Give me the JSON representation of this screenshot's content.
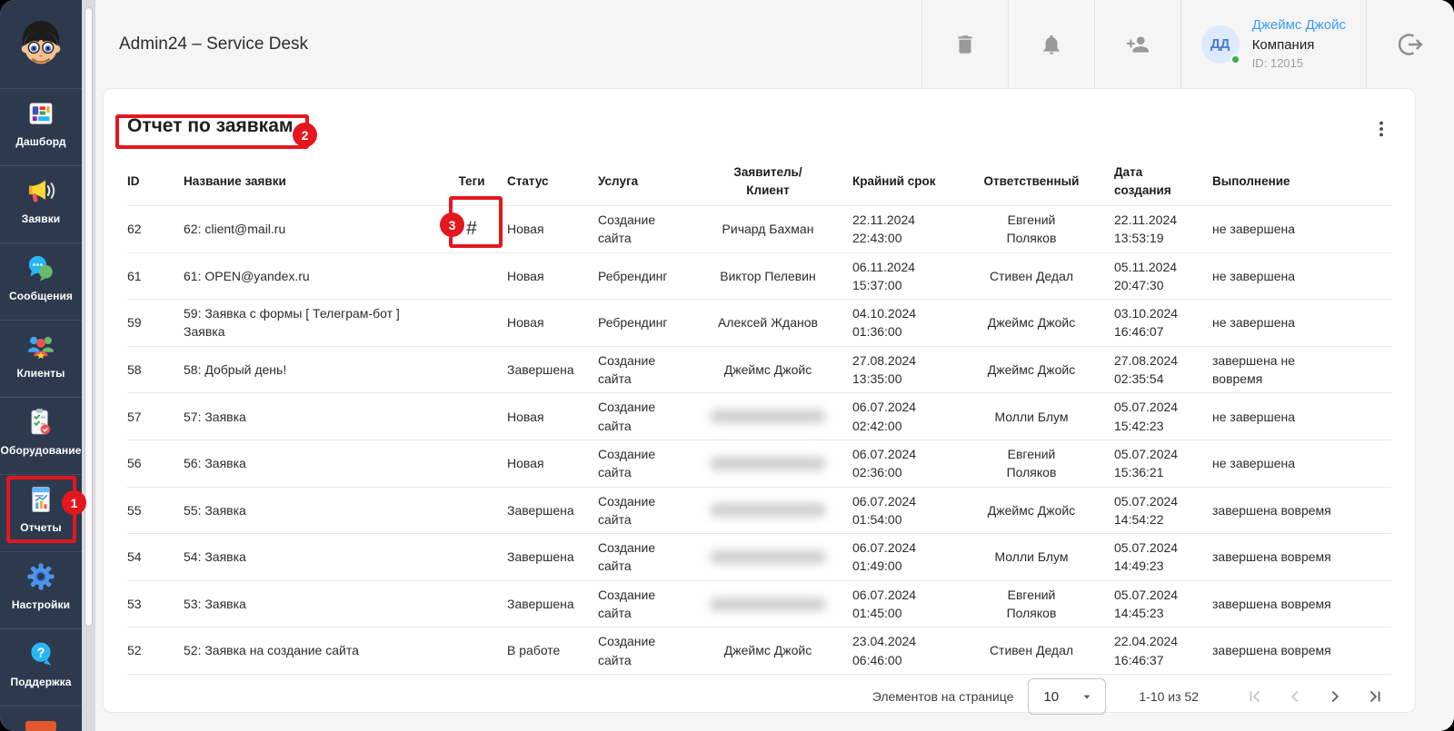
{
  "app": {
    "title": "Admin24 – Service Desk"
  },
  "sidebar": {
    "items": [
      {
        "key": "dashboard",
        "label": "Дашборд",
        "icon": "icon-dashboard"
      },
      {
        "key": "requests",
        "label": "Заявки",
        "icon": "icon-megaphone"
      },
      {
        "key": "messages",
        "label": "Сообщения",
        "icon": "icon-chat"
      },
      {
        "key": "clients",
        "label": "Клиенты",
        "icon": "icon-clients"
      },
      {
        "key": "equipment",
        "label": "Оборудование",
        "icon": "icon-equipment"
      },
      {
        "key": "reports",
        "label": "Отчеты",
        "icon": "icon-reports",
        "active": true
      },
      {
        "key": "settings",
        "label": "Настройки",
        "icon": "icon-settings"
      },
      {
        "key": "support",
        "label": "Поддержка",
        "icon": "icon-support"
      }
    ]
  },
  "header": {
    "user": {
      "initials": "ДД",
      "name": "Джеймс Джойс",
      "company": "Компания",
      "id_label": "ID: 12015"
    }
  },
  "main": {
    "title": "Отчет по заявкам",
    "table": {
      "columns": [
        {
          "key": "id",
          "label": "ID"
        },
        {
          "key": "name",
          "label": "Название заявки"
        },
        {
          "key": "tags",
          "label": "Теги"
        },
        {
          "key": "status",
          "label": "Статус"
        },
        {
          "key": "service",
          "label": "Услуга"
        },
        {
          "key": "client",
          "label": "Заявитель/\nКлиент"
        },
        {
          "key": "deadline",
          "label": "Крайний срок"
        },
        {
          "key": "responsible",
          "label": "Ответственный"
        },
        {
          "key": "created",
          "label": "Дата создания"
        },
        {
          "key": "completion",
          "label": "Выполнение"
        }
      ],
      "rows": [
        {
          "id": "62",
          "name": "62: client@mail.ru",
          "tags": "#",
          "status": "Новая",
          "service": "Создание сайта",
          "client": "Ричард Бахман",
          "client_blurred": false,
          "deadline": "22.11.2024 22:43:00",
          "responsible": "Евгений Поляков",
          "created": "22.11.2024 13:53:19",
          "completion": "не завершена"
        },
        {
          "id": "61",
          "name": "61: OPEN@yandex.ru",
          "tags": "",
          "status": "Новая",
          "service": "Ребрендинг",
          "client": "Виктор Пелевин",
          "client_blurred": false,
          "deadline": "06.11.2024 15:37:00",
          "responsible": "Стивен Дедал",
          "created": "05.11.2024 20:47:30",
          "completion": "не завершена"
        },
        {
          "id": "59",
          "name": "59: Заявка с формы [ Телеграм-бот ] Заявка",
          "tags": "",
          "status": "Новая",
          "service": "Ребрендинг",
          "client": "Алексей Жданов",
          "client_blurred": false,
          "deadline": "04.10.2024 01:36:00",
          "responsible": "Джеймс Джойс",
          "created": "03.10.2024 16:46:07",
          "completion": "не завершена"
        },
        {
          "id": "58",
          "name": "58: Добрый день!",
          "tags": "",
          "status": "Завершена",
          "service": "Создание сайта",
          "client": "Джеймс Джойс",
          "client_blurred": false,
          "deadline": "27.08.2024 13:35:00",
          "responsible": "Джеймс Джойс",
          "created": "27.08.2024 02:35:54",
          "completion": "завершена не вовремя"
        },
        {
          "id": "57",
          "name": "57: Заявка",
          "tags": "",
          "status": "Новая",
          "service": "Создание сайта",
          "client": "",
          "client_blurred": true,
          "deadline": "06.07.2024 02:42:00",
          "responsible": "Молли Блум",
          "created": "05.07.2024 15:42:23",
          "completion": "не завершена"
        },
        {
          "id": "56",
          "name": "56: Заявка",
          "tags": "",
          "status": "Новая",
          "service": "Создание сайта",
          "client": "",
          "client_blurred": true,
          "deadline": "06.07.2024 02:36:00",
          "responsible": "Евгений Поляков",
          "created": "05.07.2024 15:36:21",
          "completion": "не завершена"
        },
        {
          "id": "55",
          "name": "55: Заявка",
          "tags": "",
          "status": "Завершена",
          "service": "Создание сайта",
          "client": "",
          "client_blurred": true,
          "deadline": "06.07.2024 01:54:00",
          "responsible": "Джеймс Джойс",
          "created": "05.07.2024 14:54:22",
          "completion": "завершена вовремя"
        },
        {
          "id": "54",
          "name": "54: Заявка",
          "tags": "",
          "status": "Завершена",
          "service": "Создание сайта",
          "client": "",
          "client_blurred": true,
          "deadline": "06.07.2024 01:49:00",
          "responsible": "Молли Блум",
          "created": "05.07.2024 14:49:23",
          "completion": "завершена вовремя"
        },
        {
          "id": "53",
          "name": "53: Заявка",
          "tags": "",
          "status": "Завершена",
          "service": "Создание сайта",
          "client": "",
          "client_blurred": true,
          "deadline": "06.07.2024 01:45:00",
          "responsible": "Евгений Поляков",
          "created": "05.07.2024 14:45:23",
          "completion": "завершена вовремя"
        },
        {
          "id": "52",
          "name": "52: Заявка на создание сайта",
          "tags": "",
          "status": "В работе",
          "service": "Создание сайта",
          "client": "Джеймс Джойс",
          "client_blurred": false,
          "deadline": "23.04.2024 06:46:00",
          "responsible": "Стивен Дедал",
          "created": "22.04.2024 16:46:37",
          "completion": "завершена вовремя"
        }
      ]
    },
    "pagination": {
      "items_label": "Элементов на странице",
      "page_size": "10",
      "range_label": "1-10 из 52"
    }
  },
  "annotations": {
    "step1": "1",
    "step2": "2",
    "step3": "3"
  },
  "colors": {
    "accent_red": "#e4161e",
    "link_blue": "#3a9bef",
    "sidebar_bg": "#2d3a4e",
    "status_green": "#3dae49"
  }
}
